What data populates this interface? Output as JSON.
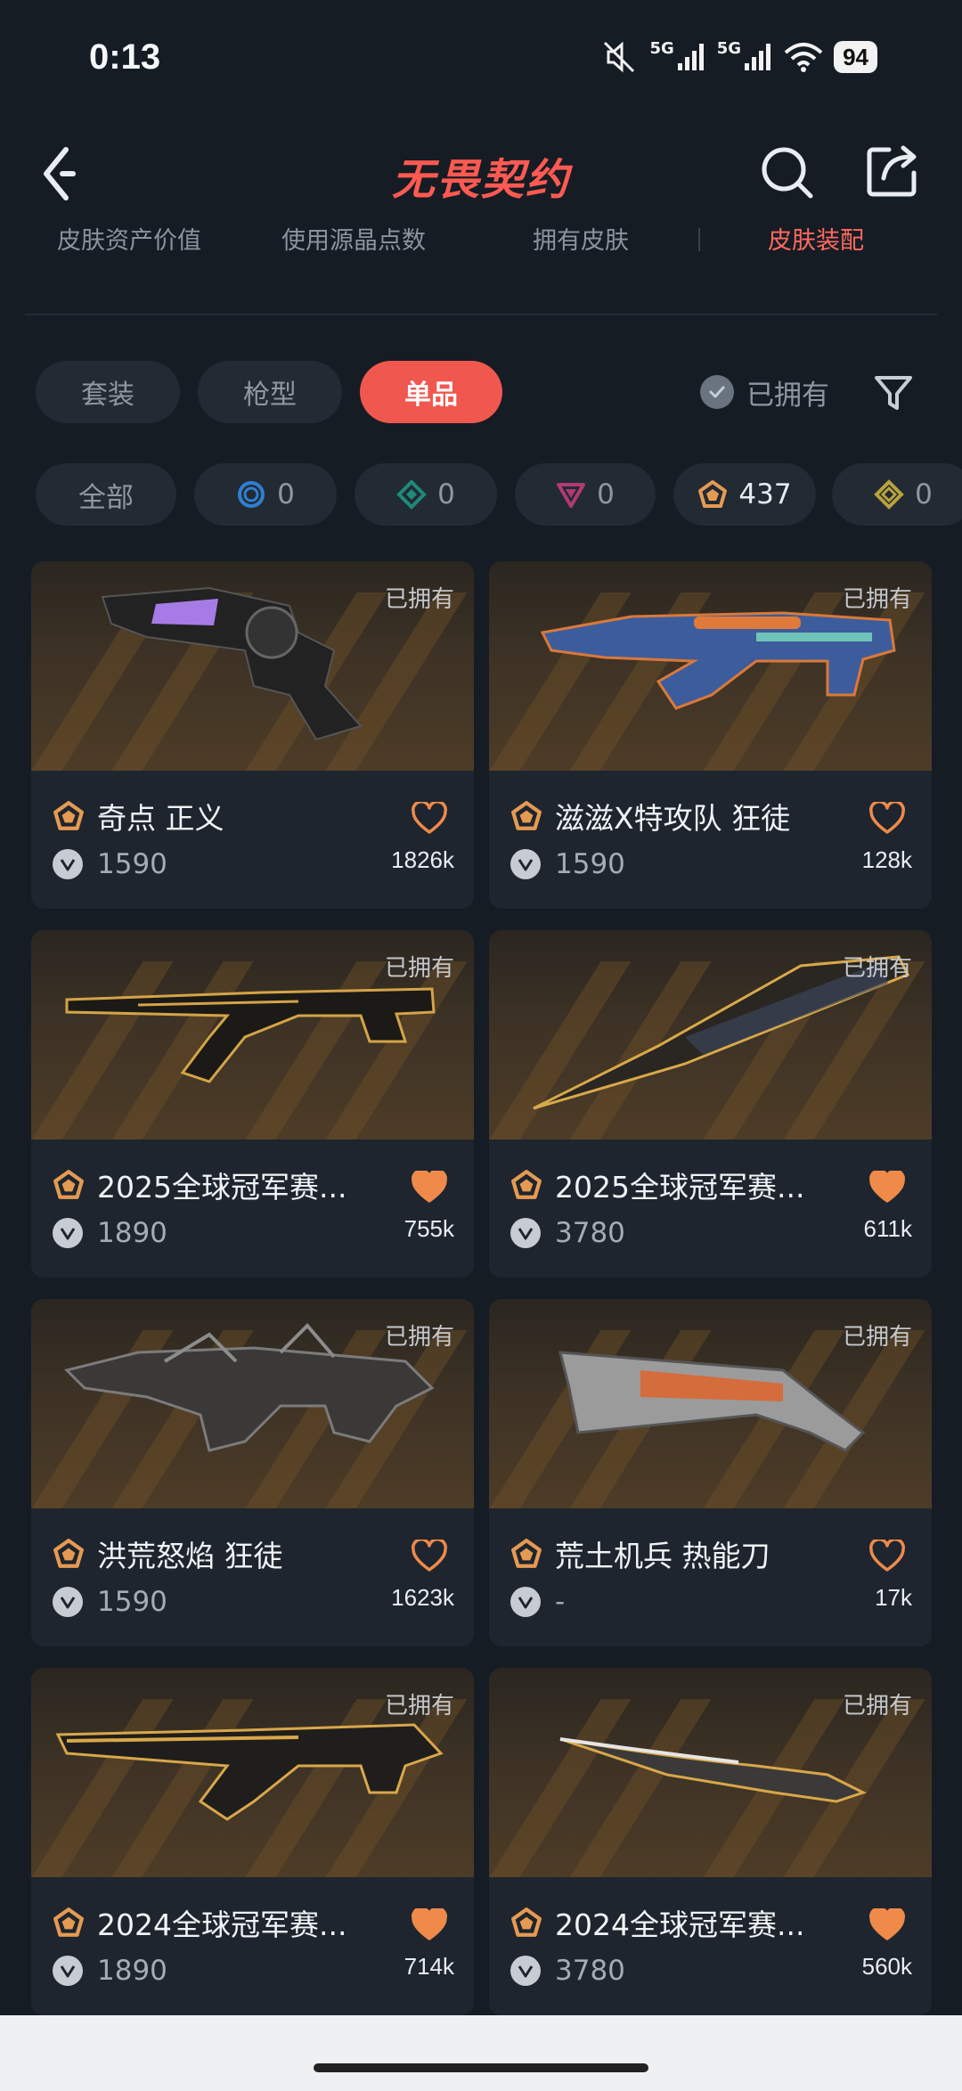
{
  "status_bar": {
    "time": "0:13",
    "network_1": "5G",
    "network_2": "5G",
    "battery": "94"
  },
  "header": {
    "title": "无畏契约",
    "back_icon": "chevron-left-icon",
    "search_icon": "search-icon",
    "share_icon": "share-icon"
  },
  "subnav": {
    "items": [
      {
        "label": "皮肤资产价值"
      },
      {
        "label": "使用源晶点数"
      },
      {
        "label": "拥有皮肤"
      },
      {
        "label": "皮肤装配"
      }
    ],
    "active_index": 3
  },
  "filters": {
    "types": [
      {
        "label": "套装"
      },
      {
        "label": "枪型"
      },
      {
        "label": "单品"
      }
    ],
    "active_type": 2,
    "owned_label": "已拥有",
    "filter_icon": "filter-icon"
  },
  "tiers": [
    {
      "label": "全部",
      "icon": null
    },
    {
      "label": "0",
      "icon": "tier-select-icon",
      "color": "#2f7fd1"
    },
    {
      "label": "0",
      "icon": "tier-deluxe-icon",
      "color": "#1d8a7a"
    },
    {
      "label": "0",
      "icon": "tier-premium-icon",
      "color": "#b03a72"
    },
    {
      "label": "437",
      "icon": "tier-exclusive-icon",
      "color": "#e59a52"
    },
    {
      "label": "0",
      "icon": "tier-ultra-icon",
      "color": "#b8a23c"
    }
  ],
  "cards": [
    {
      "badge": "已拥有",
      "name": "奇点 正义",
      "price": "1590",
      "likes": "1826k",
      "liked": false
    },
    {
      "badge": "已拥有",
      "name": "滋滋Ⅹ特攻队 狂徒",
      "price": "1590",
      "likes": "128k",
      "liked": false
    },
    {
      "badge": "已拥有",
      "name": "2025全球冠军赛...",
      "price": "1890",
      "likes": "755k",
      "liked": true
    },
    {
      "badge": "已拥有",
      "name": "2025全球冠军赛...",
      "price": "3780",
      "likes": "611k",
      "liked": true
    },
    {
      "badge": "已拥有",
      "name": "洪荒怒焰 狂徒",
      "price": "1590",
      "likes": "1623k",
      "liked": false
    },
    {
      "badge": "已拥有",
      "name": "荒土机兵 热能刀",
      "price": "-",
      "likes": "17k",
      "liked": false
    },
    {
      "badge": "已拥有",
      "name": "2024全球冠军赛...",
      "price": "1890",
      "likes": "714k",
      "liked": true
    },
    {
      "badge": "已拥有",
      "name": "2024全球冠军赛...",
      "price": "3780",
      "likes": "560k",
      "liked": true
    }
  ],
  "colors": {
    "accent": "#f0574f",
    "background": "#161c24",
    "card": "#1e252e",
    "tier_exclusive": "#e59a52",
    "heart_filled": "#ef8a4a"
  }
}
